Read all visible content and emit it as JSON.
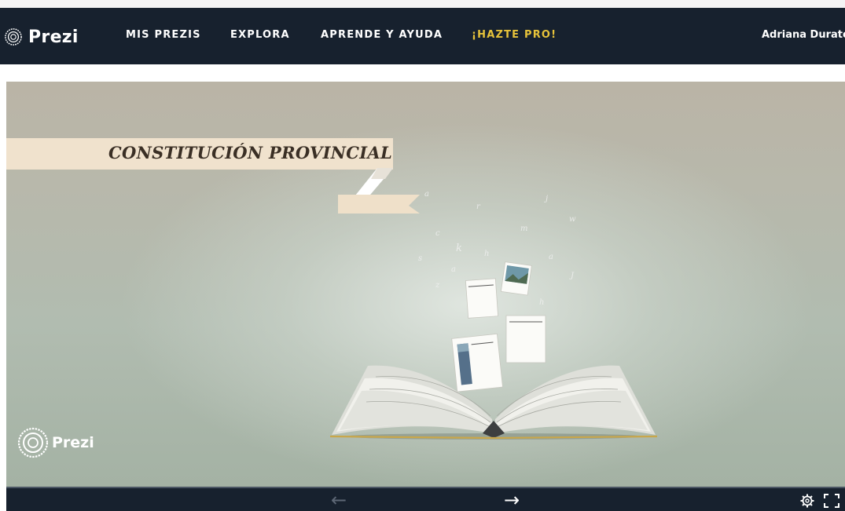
{
  "nav": {
    "logo_text": "Prezi",
    "links": [
      "MIS PREZIS",
      "EXPLORA",
      "APRENDE Y AYUDA",
      "¡HAZTE PRO!"
    ],
    "user_name": "Adriana Durato"
  },
  "presentation": {
    "title": "CONSTITUCIÓN PROVINCIAL",
    "watermark_text": "Prezi"
  },
  "controls": {
    "prev_icon": "←",
    "next_icon": "→",
    "settings_icon": "gear-icon",
    "fullscreen_icon": "fullscreen-icon"
  },
  "colors": {
    "nav_bg": "#17212e",
    "pro_accent": "#e7c33a",
    "ribbon": "#f0e2cd"
  }
}
